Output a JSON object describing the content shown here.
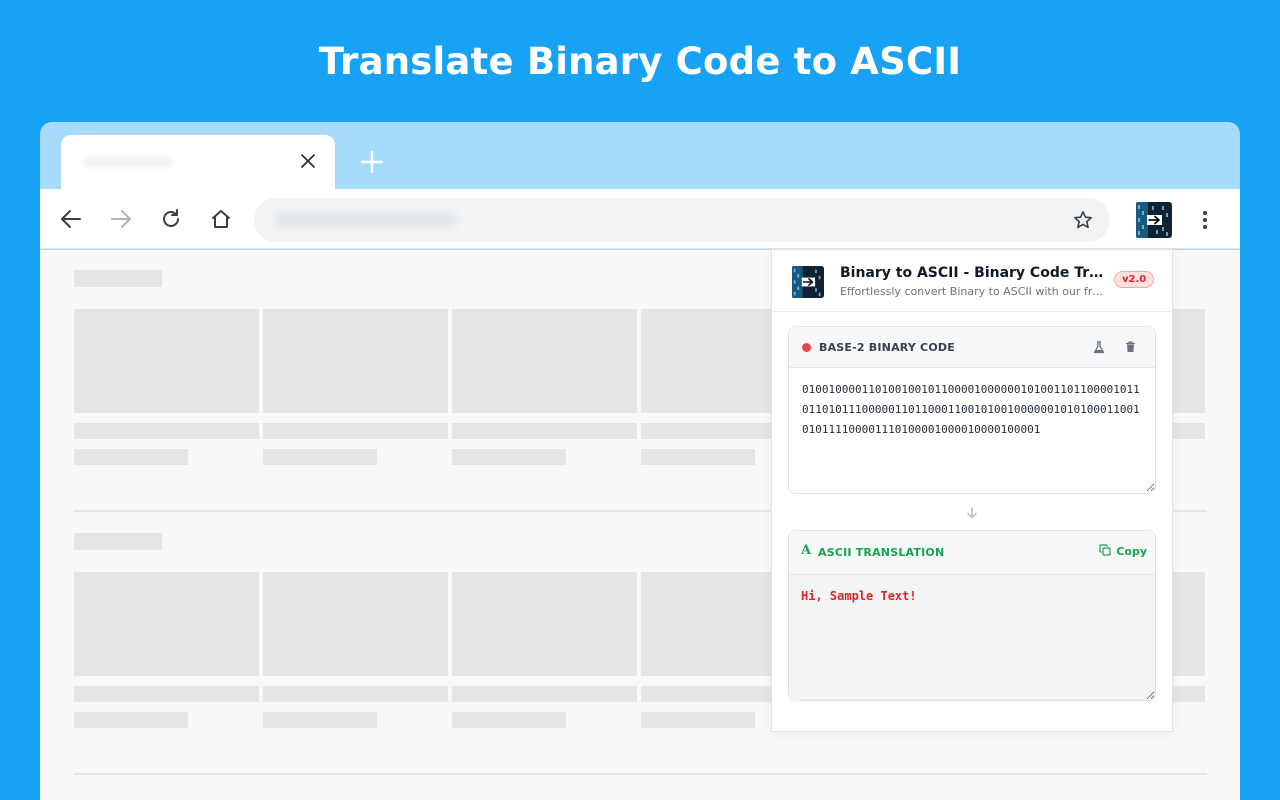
{
  "headline": "Translate Binary Code to ASCII",
  "popup": {
    "title": "Binary to ASCII - Binary Code Translator",
    "subtitle": "Effortlessly convert Binary to ASCII with our free online tool",
    "version": "v2.0",
    "binary_section": {
      "label": "BASE-2 BINARY CODE",
      "value": "010010000110100100101100001000000101001101100001011011010111000001101100011001010010000001010100011001010111100001110100001000010000100001"
    },
    "ascii_section": {
      "label": "ASCII TRANSLATION",
      "copy_label": "Copy",
      "value": "Hi, Sample Text!"
    }
  },
  "colors": {
    "page_background": "#18a2f5",
    "tab_strip": "#a6dbfb",
    "accent_red": "#dc2626",
    "accent_green": "#16a34a"
  },
  "icons": {
    "tab": [
      "close-icon",
      "plus-icon"
    ],
    "toolbar": [
      "back-arrow-icon",
      "forward-arrow-icon",
      "reload-icon",
      "home-icon",
      "star-icon",
      "extension-icon",
      "more-vertical-icon"
    ],
    "popup": [
      "flask-icon",
      "trash-icon",
      "arrow-down-icon",
      "text-a-icon",
      "copy-icon"
    ]
  }
}
